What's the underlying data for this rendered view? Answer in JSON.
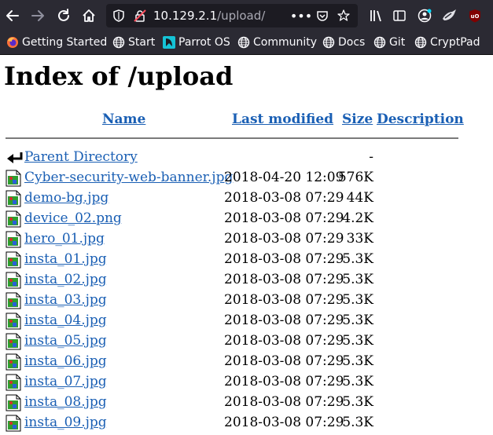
{
  "browser": {
    "url_host": "10.129.2.1",
    "url_path": "/upload/"
  },
  "bookmarks": [
    {
      "label": "Getting Started",
      "icon": "firefox-icon"
    },
    {
      "label": "Start",
      "icon": "globe-icon"
    },
    {
      "label": "Parrot OS",
      "icon": "parrot-icon"
    },
    {
      "label": "Community",
      "icon": "globe-icon"
    },
    {
      "label": "Docs",
      "icon": "globe-icon"
    },
    {
      "label": "Git",
      "icon": "globe-icon"
    },
    {
      "label": "CryptPad",
      "icon": "globe-icon"
    }
  ],
  "page": {
    "title": "Index of /upload",
    "columns": {
      "name": "Name",
      "modified": "Last modified",
      "size": "Size",
      "description": "Description"
    },
    "rows": [
      {
        "name": "Parent Directory",
        "modified": "",
        "size": "-",
        "icon": "back-arrow-icon"
      },
      {
        "name": "Cyber-security-web-banner.jpg",
        "modified": "2018-04-20 12:09",
        "size": "576K",
        "icon": "image-file-icon"
      },
      {
        "name": "demo-bg.jpg",
        "modified": "2018-03-08 07:29",
        "size": "44K",
        "icon": "image-file-icon"
      },
      {
        "name": "device_02.png",
        "modified": "2018-03-08 07:29",
        "size": "4.2K",
        "icon": "image-file-icon"
      },
      {
        "name": "hero_01.jpg",
        "modified": "2018-03-08 07:29",
        "size": "33K",
        "icon": "image-file-icon"
      },
      {
        "name": "insta_01.jpg",
        "modified": "2018-03-08 07:29",
        "size": "5.3K",
        "icon": "image-file-icon"
      },
      {
        "name": "insta_02.jpg",
        "modified": "2018-03-08 07:29",
        "size": "5.3K",
        "icon": "image-file-icon"
      },
      {
        "name": "insta_03.jpg",
        "modified": "2018-03-08 07:29",
        "size": "5.3K",
        "icon": "image-file-icon"
      },
      {
        "name": "insta_04.jpg",
        "modified": "2018-03-08 07:29",
        "size": "5.3K",
        "icon": "image-file-icon"
      },
      {
        "name": "insta_05.jpg",
        "modified": "2018-03-08 07:29",
        "size": "5.3K",
        "icon": "image-file-icon"
      },
      {
        "name": "insta_06.jpg",
        "modified": "2018-03-08 07:29",
        "size": "5.3K",
        "icon": "image-file-icon"
      },
      {
        "name": "insta_07.jpg",
        "modified": "2018-03-08 07:29",
        "size": "5.3K",
        "icon": "image-file-icon"
      },
      {
        "name": "insta_08.jpg",
        "modified": "2018-03-08 07:29",
        "size": "5.3K",
        "icon": "image-file-icon"
      },
      {
        "name": "insta_09.jpg",
        "modified": "2018-03-08 07:29",
        "size": "5.3K",
        "icon": "image-file-icon"
      }
    ]
  }
}
